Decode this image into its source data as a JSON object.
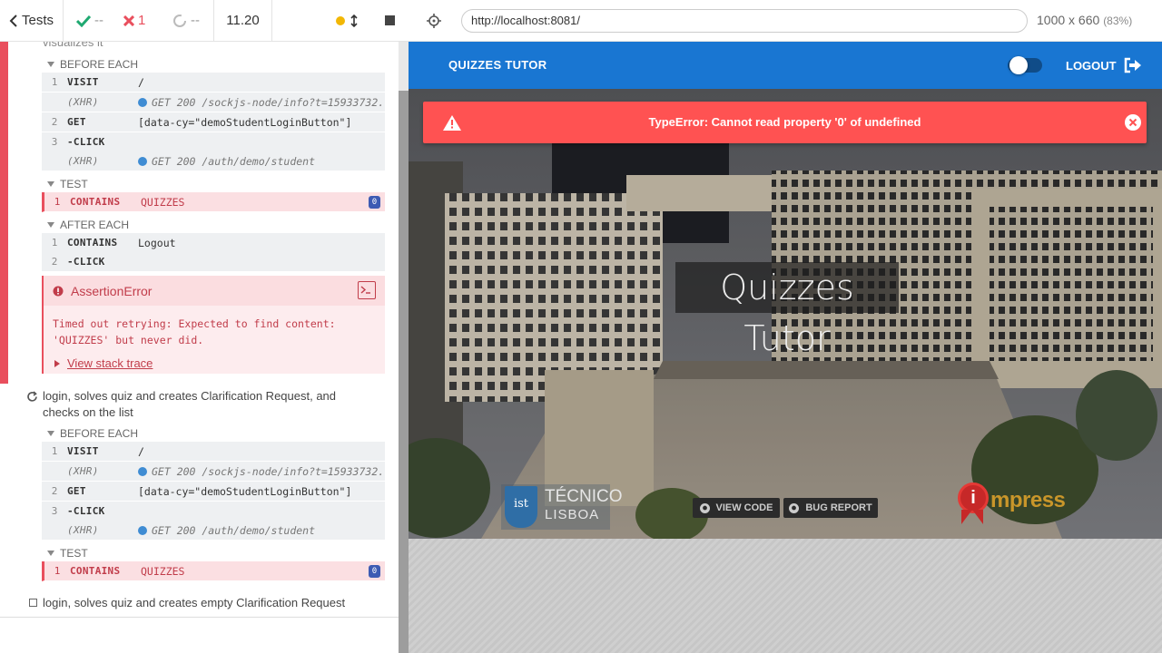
{
  "topbar": {
    "tests_label": "Tests",
    "passed": "--",
    "failed": "1",
    "pending": "--",
    "duration": "11.20"
  },
  "runs": {
    "prev_test_tail": "visualizes it",
    "hooks": {
      "before_each": "BEFORE EACH",
      "test": "TEST",
      "after_each": "AFTER EACH"
    },
    "block1": [
      {
        "num": "1",
        "name": "VISIT",
        "msg": "/"
      },
      {
        "num": "",
        "name": "(XHR)",
        "msg": "GET 200 /sockjs-node/info?t=15933732..."
      },
      {
        "num": "2",
        "name": "GET",
        "msg": "[data-cy=\"demoStudentLoginButton\"]"
      },
      {
        "num": "3",
        "name": "-CLICK",
        "msg": ""
      },
      {
        "num": "",
        "name": "(XHR)",
        "msg": "GET 200 /auth/demo/student"
      }
    ],
    "test1": {
      "num": "1",
      "name": "CONTAINS",
      "msg": "QUIZZES",
      "badge": "0"
    },
    "after1": [
      {
        "num": "1",
        "name": "CONTAINS",
        "msg": "Logout"
      },
      {
        "num": "2",
        "name": "-CLICK",
        "msg": ""
      }
    ],
    "error": {
      "title": "AssertionError",
      "message_line1": "Timed out retrying: Expected to find content:",
      "message_line2": "'QUIZZES' but never did.",
      "stack_link": "View stack trace"
    },
    "test2_title": "login, solves quiz and creates Clarification Request, and checks on the list",
    "block2": [
      {
        "num": "1",
        "name": "VISIT",
        "msg": "/"
      },
      {
        "num": "",
        "name": "(XHR)",
        "msg": "GET 200 /sockjs-node/info?t=15933732..."
      },
      {
        "num": "2",
        "name": "GET",
        "msg": "[data-cy=\"demoStudentLoginButton\"]"
      },
      {
        "num": "3",
        "name": "-CLICK",
        "msg": ""
      },
      {
        "num": "",
        "name": "(XHR)",
        "msg": "GET 200 /auth/demo/student"
      }
    ],
    "test2": {
      "num": "1",
      "name": "CONTAINS",
      "msg": "QUIZZES",
      "badge": "0"
    },
    "test3_title": "login, solves quiz and creates empty Clarification Request"
  },
  "aut": {
    "url": "http://localhost:8081/",
    "viewport": "1000 x 660",
    "scale": "(83%)"
  },
  "app": {
    "brand": "QUIZZES TUTOR",
    "logout_label": "LOGOUT",
    "alert_text": "TypeError: Cannot read property '0' of undefined",
    "hero_title": "Quizzes Tutor",
    "view_code": "VIEW CODE",
    "bug_report": "BUG REPORT",
    "tecnico_line1": "TÉCNICO",
    "tecnico_line2": "LISBOA",
    "tecnico_mark": "ist",
    "impress_label": "mpress"
  },
  "colors": {
    "app_bar": "#1976d2",
    "alert": "#ff5252",
    "fail_red": "#e94f5d",
    "pass_green": "#1fa971",
    "running_yellow": "#f2b705"
  }
}
